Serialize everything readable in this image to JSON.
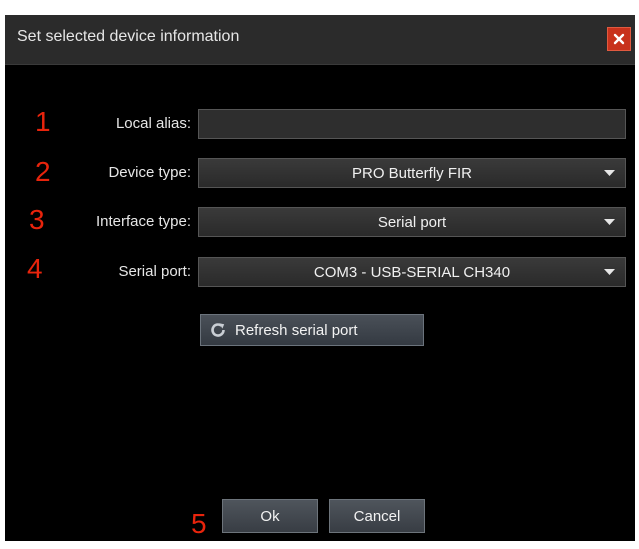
{
  "dialog": {
    "title": "Set selected device information",
    "close_icon": "close-icon"
  },
  "fields": [
    {
      "number": "1",
      "label": "Local alias:",
      "value": ""
    },
    {
      "number": "2",
      "label": "Device type:",
      "value": "PRO Butterfly FIR"
    },
    {
      "number": "3",
      "label": "Interface type:",
      "value": "Serial port"
    },
    {
      "number": "4",
      "label": "Serial port:",
      "value": "COM3 - USB-SERIAL CH340"
    }
  ],
  "refresh": {
    "label": "Refresh serial port",
    "icon": "refresh-icon"
  },
  "footer": {
    "number": "5",
    "ok_label": "Ok",
    "cancel_label": "Cancel"
  },
  "colors": {
    "annotation_number": "#e8240c",
    "close_button": "#c8321c"
  }
}
